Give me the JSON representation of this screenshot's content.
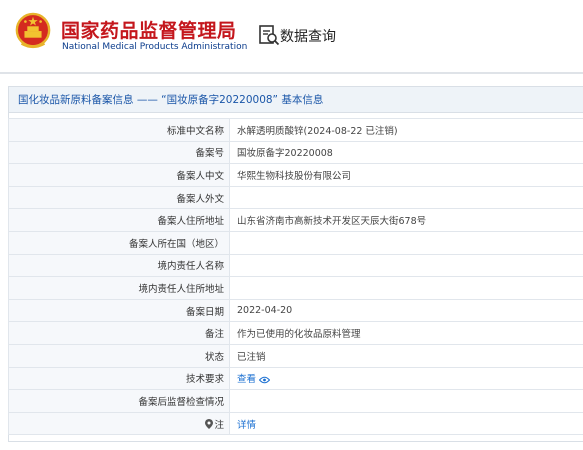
{
  "header": {
    "org_name_cn": "国家药品监督管理局",
    "org_name_en": "National Medical Products Administration",
    "query_label": "数据查询",
    "emblem_icon": "national-emblem",
    "query_icon": "document-search-icon"
  },
  "panel": {
    "title": "国化妆品新原料备案信息 —— “国妆原备字20220008” 基本信息"
  },
  "rows": [
    {
      "label": "标准中文名称",
      "value": "水解透明质酸锌(2024-08-22 已注销)"
    },
    {
      "label": "备案号",
      "value": "国妆原备字20220008"
    },
    {
      "label": "备案人中文",
      "value": "华熙生物科技股份有限公司"
    },
    {
      "label": "备案人外文",
      "value": ""
    },
    {
      "label": "备案人住所地址",
      "value": "山东省济南市高新技术开发区天辰大街678号"
    },
    {
      "label": "备案人所在国（地区）",
      "value": ""
    },
    {
      "label": "境内责任人名称",
      "value": ""
    },
    {
      "label": "境内责任人住所地址",
      "value": ""
    },
    {
      "label": "备案日期",
      "value": "2022-04-20"
    },
    {
      "label": "备注",
      "value": "作为已使用的化妆品原料管理"
    },
    {
      "label": "状态",
      "value": "已注销"
    },
    {
      "label": "技术要求",
      "value": "查看",
      "icon": "eye-icon"
    },
    {
      "label": "备案后监督检查情况",
      "value": ""
    },
    {
      "label": "注",
      "value": "详情",
      "icon": "location-pin-icon"
    }
  ],
  "colors": {
    "brand_red": "#c4161c",
    "brand_blue": "#0b3c8c",
    "link_blue": "#1a6fd1",
    "title_blue": "#1a56a8"
  }
}
